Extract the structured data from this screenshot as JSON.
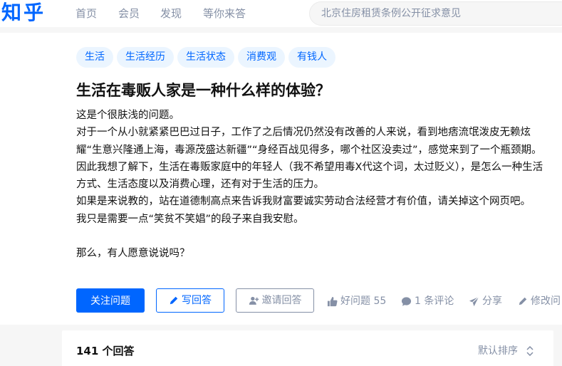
{
  "header": {
    "logo": "知乎",
    "nav": [
      "首页",
      "会员",
      "发现",
      "等你来答"
    ],
    "search_placeholder": "北京住房租赁条例公开征求意见"
  },
  "question": {
    "topics": [
      "生活",
      "生活经历",
      "生活状态",
      "消费观",
      "有钱人"
    ],
    "title": "生活在毒贩人家是一种什么样的体验？",
    "detail": [
      "这是个很肤浅的问题。",
      "对于一个从小就紧紧巴巴过日子，工作了之后情况仍然没有改善的人来说，看到地痞流氓泼皮无赖炫耀“生意兴隆通上海，毒源茂盛达新疆”“身经百战见得多，哪个社区没卖过”，感觉来到了一个瓶颈期。",
      "因此我想了解下，生活在毒贩家庭中的年轻人（我不希望用毒X代这个词，太过贬义），是怎么一种生活方式、生活态度以及消费心理，还有对于生活的压力。",
      "如果是来说教的，站在道德制高点来告诉我财富要诚实劳动合法经营才有价值，请关掉这个网页吧。",
      "我只是需要一点“笑贫不笑娼”的段子来自我安慰。",
      "",
      "那么，有人愿意说说吗？"
    ]
  },
  "actions": {
    "follow": "关注问题",
    "write": "写回答",
    "invite": "邀请回答",
    "good_question": "好问题 55",
    "comments": "1 条评论",
    "share": "分享",
    "edit": "修改问"
  },
  "answers": {
    "count_label": "141 个回答",
    "sort_label": "默认排序"
  },
  "colors": {
    "accent": "#0066ff",
    "muted": "#8590a6",
    "tag_bg": "#ebf5ff"
  }
}
